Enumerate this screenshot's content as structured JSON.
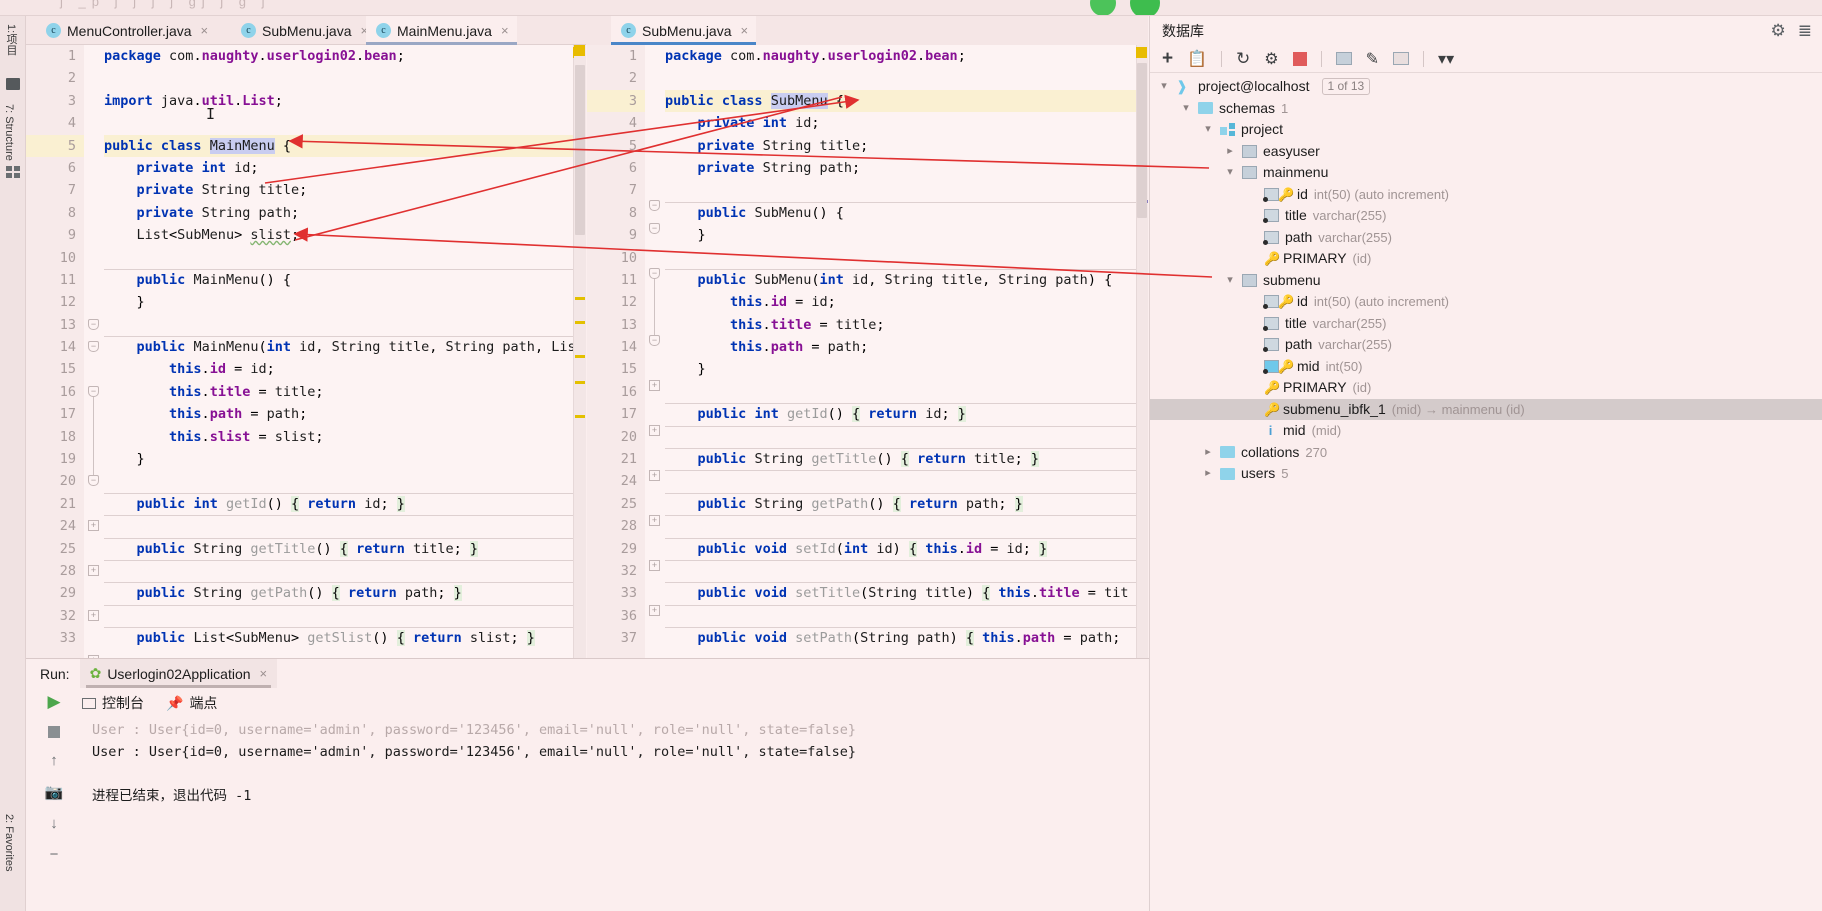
{
  "window": {
    "top_ghost_text": "j  _p            j     j     j     j        gj  j     g j"
  },
  "left_rail": {
    "project_label": "1:项目",
    "structure_label": "7: Structure",
    "favorites_label": "2: Favorites",
    "icons": [
      "folder-icon",
      "grid-icon",
      "star-icon",
      "camera-icon"
    ]
  },
  "tabs": {
    "left_group": [
      {
        "label": "MenuController.java",
        "icon": "java-class-icon",
        "close": "×",
        "active": false
      },
      {
        "label": "SubMenu.java",
        "icon": "java-class-icon",
        "close": "×",
        "active": false
      },
      {
        "label": "MainMenu.java",
        "icon": "java-class-icon",
        "close": "×",
        "active": true
      }
    ],
    "right_group": [
      {
        "label": "SubMenu.java",
        "icon": "java-class-icon",
        "close": "×",
        "active": true
      }
    ]
  },
  "editor_left": {
    "file": "MainMenu.java",
    "lines": [
      {
        "n": "1",
        "text": "package com.naughty.userlogin02.bean;"
      },
      {
        "n": "2",
        "text": ""
      },
      {
        "n": "3",
        "text": "import java.util.List;"
      },
      {
        "n": "4",
        "text": ""
      },
      {
        "n": "5",
        "text": "public class MainMenu {"
      },
      {
        "n": "6",
        "text": "    private int id;"
      },
      {
        "n": "7",
        "text": "    private String title;"
      },
      {
        "n": "8",
        "text": "    private String path;"
      },
      {
        "n": "9",
        "text": "    List<SubMenu> slist;"
      },
      {
        "n": "10",
        "text": ""
      },
      {
        "n": "11",
        "text": "    public MainMenu() {"
      },
      {
        "n": "12",
        "text": "    }"
      },
      {
        "n": "13",
        "text": ""
      },
      {
        "n": "14",
        "text": "    public MainMenu(int id, String title, String path, Lis"
      },
      {
        "n": "15",
        "text": "        this.id = id;"
      },
      {
        "n": "16",
        "text": "        this.title = title;"
      },
      {
        "n": "17",
        "text": "        this.path = path;"
      },
      {
        "n": "18",
        "text": "        this.slist = slist;"
      },
      {
        "n": "19",
        "text": "    }"
      },
      {
        "n": "20",
        "text": ""
      },
      {
        "n": "21",
        "text": "    public int getId() { return id; }"
      },
      {
        "n": "24",
        "text": ""
      },
      {
        "n": "25",
        "text": "    public String getTitle() { return title; }"
      },
      {
        "n": "28",
        "text": ""
      },
      {
        "n": "29",
        "text": "    public String getPath() { return path; }"
      },
      {
        "n": "32",
        "text": ""
      },
      {
        "n": "33",
        "text": "    public List<SubMenu> getSlist() { return slist; }"
      }
    ]
  },
  "editor_right": {
    "file": "SubMenu.java",
    "lines": [
      {
        "n": "1",
        "text": "package com.naughty.userlogin02.bean;"
      },
      {
        "n": "2",
        "text": ""
      },
      {
        "n": "3",
        "text": "public class SubMenu {"
      },
      {
        "n": "4",
        "text": "    private int id;"
      },
      {
        "n": "5",
        "text": "    private String title;"
      },
      {
        "n": "6",
        "text": "    private String path;"
      },
      {
        "n": "7",
        "text": ""
      },
      {
        "n": "8",
        "text": "    public SubMenu() {"
      },
      {
        "n": "9",
        "text": "    }"
      },
      {
        "n": "10",
        "text": ""
      },
      {
        "n": "11",
        "text": "    public SubMenu(int id, String title, String path) {"
      },
      {
        "n": "12",
        "text": "        this.id = id;"
      },
      {
        "n": "13",
        "text": "        this.title = title;"
      },
      {
        "n": "14",
        "text": "        this.path = path;"
      },
      {
        "n": "15",
        "text": "    }"
      },
      {
        "n": "16",
        "text": ""
      },
      {
        "n": "17",
        "text": "    public int getId() { return id; }"
      },
      {
        "n": "20",
        "text": ""
      },
      {
        "n": "21",
        "text": "    public String getTitle() { return title; }"
      },
      {
        "n": "24",
        "text": ""
      },
      {
        "n": "25",
        "text": "    public String getPath() { return path; }"
      },
      {
        "n": "28",
        "text": ""
      },
      {
        "n": "29",
        "text": "    public void setId(int id) { this.id = id; }"
      },
      {
        "n": "32",
        "text": ""
      },
      {
        "n": "33",
        "text": "    public void setTitle(String title) { this.title = tit"
      },
      {
        "n": "36",
        "text": ""
      },
      {
        "n": "37",
        "text": "    public void setPath(String path) { this.path = path; "
      }
    ]
  },
  "database": {
    "title": "数据库",
    "header_actions": [
      "settings-icon",
      "collapse-all-icon"
    ],
    "toolbar": [
      "add-icon",
      "copy-icon",
      "refresh-icon",
      "run-sql-icon",
      "stop-icon",
      "table-icon",
      "edit-icon",
      "console-icon",
      "filter-icon"
    ],
    "tree": [
      {
        "indent": 0,
        "chevron": "v",
        "icon": "dolphin-icon",
        "label": "project@localhost",
        "meta": "",
        "badge": "1 of 13",
        "selected": false
      },
      {
        "indent": 1,
        "chevron": "v",
        "icon": "folder-icon",
        "label": "schemas",
        "meta": "1",
        "badge": "",
        "selected": false
      },
      {
        "indent": 2,
        "chevron": "v",
        "icon": "schema-icon",
        "label": "project",
        "meta": "",
        "badge": "",
        "selected": false
      },
      {
        "indent": 3,
        "chevron": ">",
        "icon": "table-icon",
        "label": "easyuser",
        "meta": "",
        "badge": "",
        "selected": false
      },
      {
        "indent": 3,
        "chevron": "v",
        "icon": "table-icon",
        "label": "mainmenu",
        "meta": "",
        "badge": "",
        "selected": false
      },
      {
        "indent": 4,
        "chevron": "",
        "icon": "column-key-icon",
        "label": "id",
        "meta": "int(50) (auto increment)",
        "badge": "",
        "selected": false
      },
      {
        "indent": 4,
        "chevron": "",
        "icon": "column-icon",
        "label": "title",
        "meta": "varchar(255)",
        "badge": "",
        "selected": false
      },
      {
        "indent": 4,
        "chevron": "",
        "icon": "column-icon",
        "label": "path",
        "meta": "varchar(255)",
        "badge": "",
        "selected": false
      },
      {
        "indent": 4,
        "chevron": "",
        "icon": "key-icon",
        "label": "PRIMARY",
        "meta": "(id)",
        "badge": "",
        "selected": false
      },
      {
        "indent": 3,
        "chevron": "v",
        "icon": "table-icon",
        "label": "submenu",
        "meta": "",
        "badge": "",
        "selected": false
      },
      {
        "indent": 4,
        "chevron": "",
        "icon": "column-key-icon",
        "label": "id",
        "meta": "int(50) (auto increment)",
        "badge": "",
        "selected": false
      },
      {
        "indent": 4,
        "chevron": "",
        "icon": "column-icon",
        "label": "title",
        "meta": "varchar(255)",
        "badge": "",
        "selected": false
      },
      {
        "indent": 4,
        "chevron": "",
        "icon": "column-icon",
        "label": "path",
        "meta": "varchar(255)",
        "badge": "",
        "selected": false
      },
      {
        "indent": 4,
        "chevron": "",
        "icon": "column-fk-icon",
        "label": "mid",
        "meta": "int(50)",
        "badge": "",
        "selected": false
      },
      {
        "indent": 4,
        "chevron": "",
        "icon": "key-icon",
        "label": "PRIMARY",
        "meta": "(id)",
        "badge": "",
        "selected": false
      },
      {
        "indent": 4,
        "chevron": "",
        "icon": "foreign-key-icon",
        "label": "submenu_ibfk_1",
        "meta": "(mid) → mainmenu (id)",
        "badge": "",
        "selected": true
      },
      {
        "indent": 4,
        "chevron": "",
        "icon": "index-icon",
        "label": "mid",
        "meta": "(mid)",
        "badge": "",
        "selected": false
      },
      {
        "indent": 2,
        "chevron": ">",
        "icon": "folder-icon",
        "label": "collations",
        "meta": "270",
        "badge": "",
        "selected": false
      },
      {
        "indent": 2,
        "chevron": ">",
        "icon": "folder-icon",
        "label": "users",
        "meta": "5",
        "badge": "",
        "selected": false
      }
    ]
  },
  "run_panel": {
    "run_label": "Run:",
    "configuration": "Userlogin02Application",
    "close": "×",
    "subtabs": [
      {
        "label": "控制台",
        "icon": "console-icon"
      },
      {
        "label": "端点",
        "icon": "endpoints-icon"
      }
    ],
    "side_icons": [
      "run-icon",
      "stop-icon",
      "scroll-up-icon",
      "camera-icon",
      "scroll-down-icon",
      "minus-icon"
    ],
    "console_lines": [
      {
        "text": "User : User{id=0, username='admin', password='123456', email='null', role='null', state=false}",
        "faded": true
      },
      {
        "text": "User : User{id=0, username='admin', password='123456', email='null', role='null', state=false}",
        "faded": false
      },
      {
        "text": "",
        "faded": false
      },
      {
        "text": "进程已结束，退出代码 -1",
        "faded": false
      }
    ]
  },
  "annotations": {
    "arrow_color": "#e03030",
    "arrows": [
      {
        "name": "mainmenu-table-to-mainmenu-class"
      },
      {
        "name": "submenu-table-to-slist-field"
      },
      {
        "name": "submenu-class-to-submenu-table"
      },
      {
        "name": "mainmenu-class-to-subclass"
      }
    ]
  }
}
